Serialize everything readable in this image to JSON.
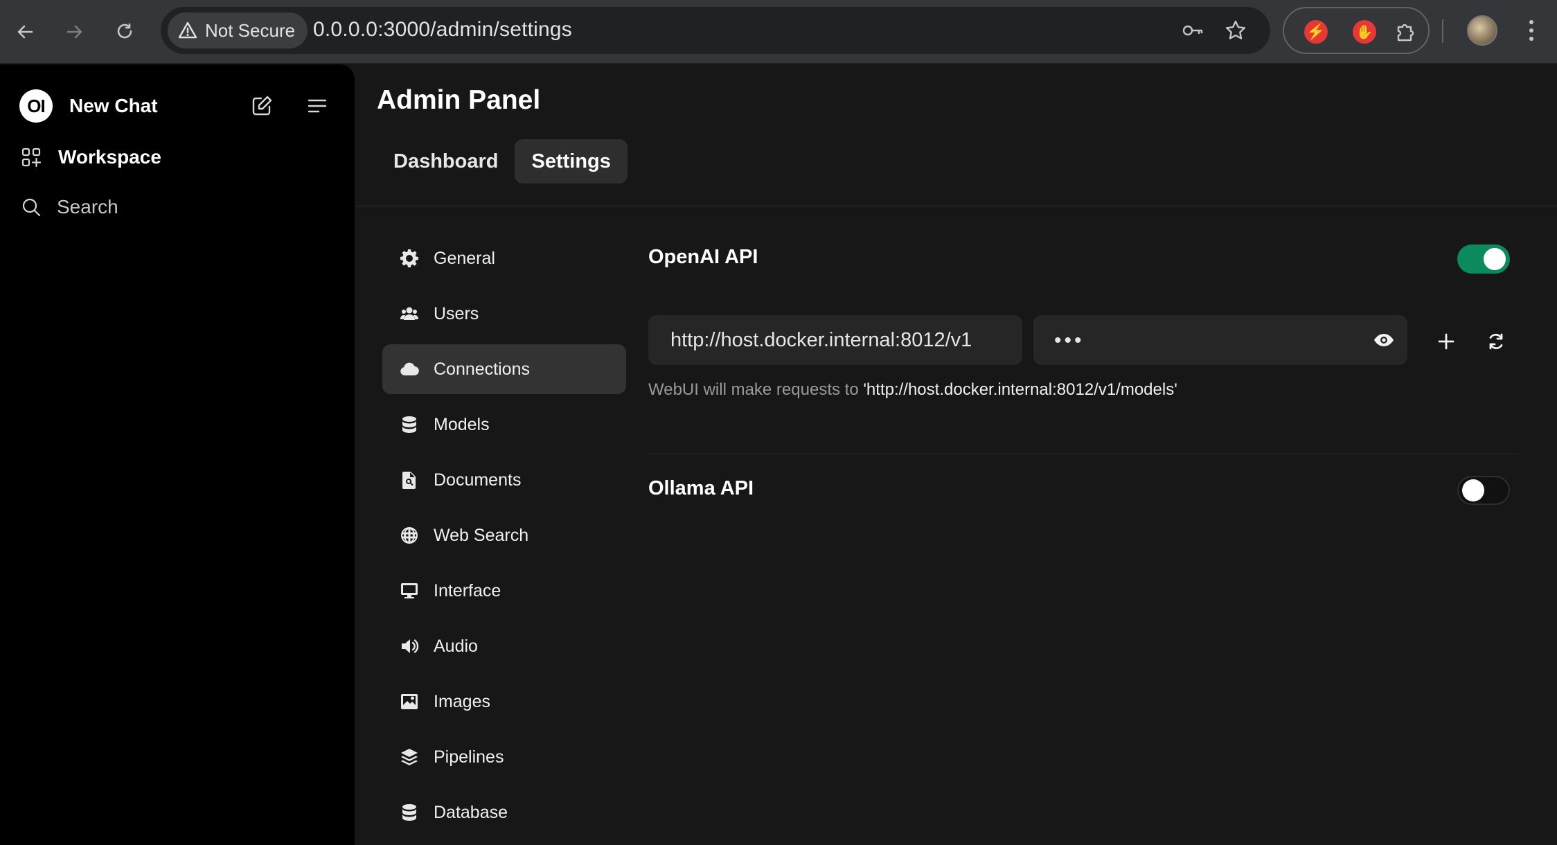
{
  "browser": {
    "security_label": "Not Secure",
    "url": "0.0.0.0:3000/admin/settings",
    "icons": [
      "back-arrow-icon",
      "forward-arrow-icon",
      "reload-icon",
      "warning-triangle-icon",
      "key-icon",
      "star-icon",
      "extension-red-bolt-icon",
      "extension-red-hand-icon",
      "puzzle-icon",
      "profile-avatar",
      "more-vertical-icon"
    ]
  },
  "sidebar": {
    "logo_text": "OI",
    "new_chat_label": "New Chat",
    "workspace_label": "Workspace",
    "search_label": "Search"
  },
  "header": {
    "title": "Admin Panel",
    "tabs": [
      {
        "label": "Dashboard",
        "active": false
      },
      {
        "label": "Settings",
        "active": true
      }
    ]
  },
  "settings_nav": [
    {
      "label": "General",
      "icon": "gear-icon"
    },
    {
      "label": "Users",
      "icon": "users-icon"
    },
    {
      "label": "Connections",
      "icon": "cloud-icon",
      "active": true
    },
    {
      "label": "Models",
      "icon": "database-icon"
    },
    {
      "label": "Documents",
      "icon": "document-search-icon"
    },
    {
      "label": "Web Search",
      "icon": "globe-icon"
    },
    {
      "label": "Interface",
      "icon": "monitor-icon"
    },
    {
      "label": "Audio",
      "icon": "speaker-icon"
    },
    {
      "label": "Images",
      "icon": "image-icon"
    },
    {
      "label": "Pipelines",
      "icon": "layers-icon"
    },
    {
      "label": "Database",
      "icon": "database-icon"
    }
  ],
  "connections": {
    "openai": {
      "title": "OpenAI API",
      "enabled": true,
      "base_url": "http://host.docker.internal:8012/v1",
      "api_key_masked": "•••",
      "hint_prefix": "WebUI will make requests to ",
      "hint_url": "'http://host.docker.internal:8012/v1/models'"
    },
    "ollama": {
      "title": "Ollama API",
      "enabled": false
    }
  },
  "colors": {
    "toggle_on": "#0c8a5d",
    "sidebar_bg": "#000000",
    "main_bg": "#171717"
  }
}
